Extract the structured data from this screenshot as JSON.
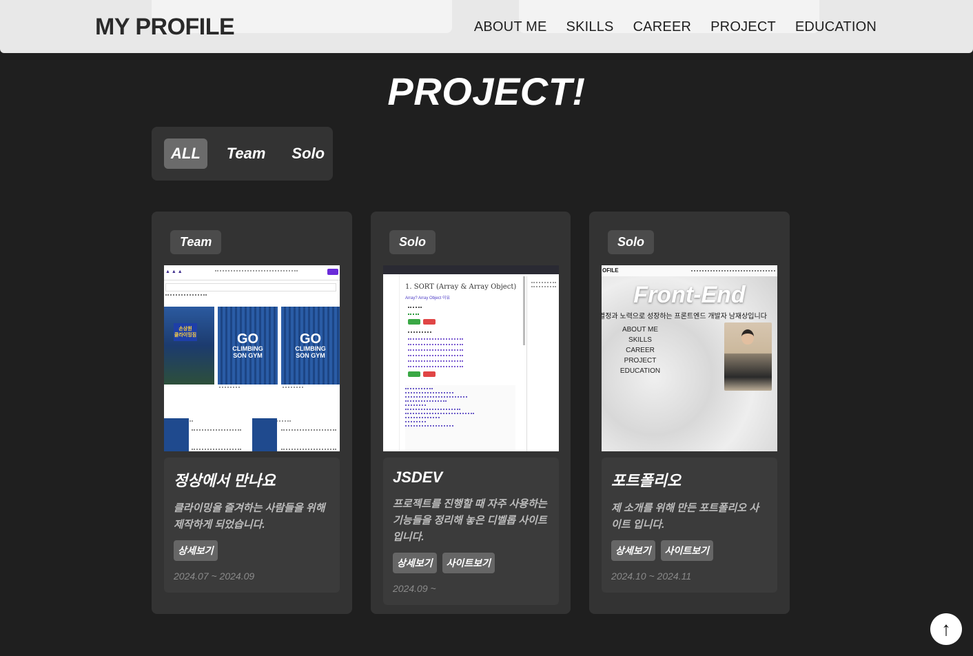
{
  "header": {
    "logo": "MY PROFILE",
    "nav": [
      "ABOUT ME",
      "SKILLS",
      "CAREER",
      "PROJECT",
      "EDUCATION"
    ]
  },
  "page_title": "PROJECT!",
  "filters": {
    "items": [
      "ALL",
      "Team",
      "Solo"
    ],
    "active": "ALL"
  },
  "projects": [
    {
      "badge": "Team",
      "title": "정상에서 만나요",
      "description": "클라이밍을 즐겨하는 사람들을 위해 제작하게 되었습니다.",
      "buttons": [
        "상세보기"
      ],
      "date": "2024.07 ~ 2024.09",
      "thumb": {
        "sign": "손상원\n클라이밍짐",
        "go": "GO",
        "go_sub": "CLIMBING\nSON GYM"
      }
    },
    {
      "badge": "Solo",
      "title": "JSDEV",
      "description": "프로젝트를 진행할 때 자주 사용하는 기능들을 정리해 놓은 디벨롭 사이트 입니다.",
      "buttons": [
        "상세보기",
        "사이트보기"
      ],
      "date": "2024.09 ~",
      "thumb": {
        "heading": "1. SORT (Array & Array Object)",
        "sub": "Array?  Array Object 이유"
      }
    },
    {
      "badge": "Solo",
      "title": "포트폴리오",
      "description": "제 소개를 위해 만든 포트폴리오 사이트 입니다.",
      "buttons": [
        "상세보기",
        "사이트보기"
      ],
      "date": "2024.10 ~ 2024.11",
      "thumb": {
        "logo": "OFILE",
        "hero": "Front-End",
        "intro": "열정과 노력으로 성장하는 프론트엔드 개발자 남재상입니다",
        "menu": [
          "ABOUT ME",
          "SKILLS",
          "CAREER",
          "PROJECT",
          "EDUCATION"
        ]
      }
    }
  ],
  "scroll_top": {
    "icon": "arrow-up-icon",
    "glyph": "↑"
  },
  "colors": {
    "background": "#1f1f1f",
    "header": "#e8e8e8",
    "card": "#333333",
    "card_info": "#3b3b3b",
    "active_filter": "#6b6b6b"
  }
}
